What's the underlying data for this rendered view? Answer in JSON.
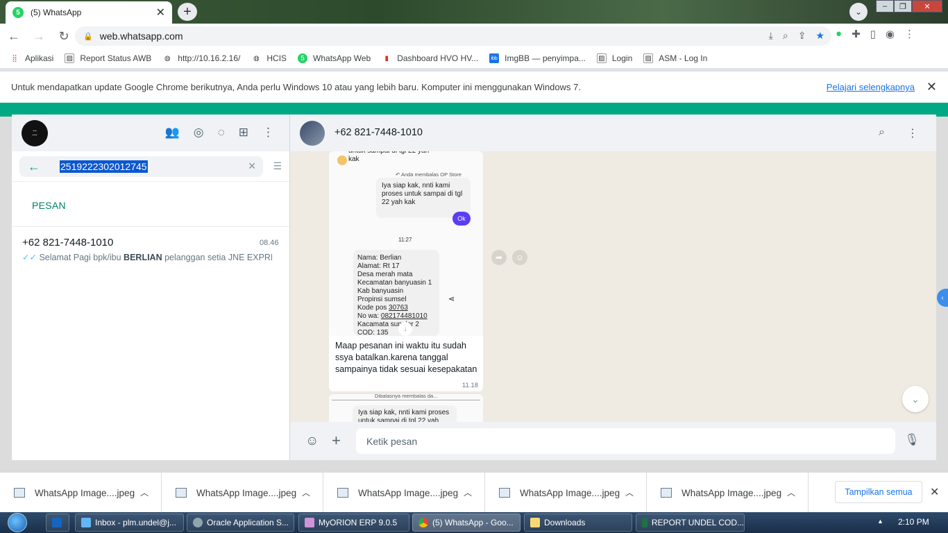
{
  "browser": {
    "tab_title": "(5) WhatsApp",
    "url": "web.whatsapp.com",
    "bookmarks": [
      {
        "label": "Aplikasi"
      },
      {
        "label": "Report Status AWB"
      },
      {
        "label": "http://10.16.2.16/"
      },
      {
        "label": "HCIS"
      },
      {
        "label": "WhatsApp Web"
      },
      {
        "label": "Dashboard HVO HV..."
      },
      {
        "label": "ImgBB — penyimpa..."
      },
      {
        "label": "Login"
      },
      {
        "label": "ASM - Log In"
      }
    ],
    "infobar_text": "Untuk mendapatkan update Google Chrome berikutnya, Anda perlu Windows 10 atau yang lebih baru. Komputer ini menggunakan Windows 7.",
    "infobar_link": "Pelajari selengkapnya"
  },
  "whatsapp": {
    "search": {
      "value": "2519222302012745"
    },
    "section_label": "PESAN",
    "result": {
      "name": "+62 821-7448-1010",
      "time": "08.46",
      "preview_prefix": "Selamat Pagi  bpk/ibu ",
      "preview_bold": "BERLIAN",
      "preview_suffix": " pelanggan setia JNE EXPRE..."
    },
    "contact_name": "+62 821-7448-1010",
    "screenshot": {
      "top_text": "untuk sampai di tgl 22 yah\nkak",
      "reply_label": "↶ Anda membalas OP Store",
      "outgoing": "Iya siap kak, nnti kami proses untuk sampai di tgl 22 yah kak",
      "ok": "Ok",
      "time": "11:27",
      "card_lines": [
        "Nama: Berlian",
        "Alamat: Rt 17",
        "Desa merah mata",
        "Kecamatan banyuasin 1",
        "Kab banyuasin",
        "Propinsi sumsel"
      ],
      "kode_pos_label": "Kode pos ",
      "kode_pos": "30763",
      "no_wa_label": "No wa: ",
      "no_wa": "082174481010",
      "card_line_kacamata": "Kacamata sunglor 2",
      "card_line_cod": "COD: 135"
    },
    "caption": "Maap pesanan ini waktu itu sudah ssya batalkan.karena tanggal sampainya tidak sesuai kesepakatan",
    "caption_time": "11.18",
    "second_bubble_text": "Iya siap kak, nnti kami proses untuk sampai di tgl 22 yah",
    "second_bubble_reply": "Dibalasnya membalas da...",
    "compose_placeholder": "Ketik pesan"
  },
  "downloads": {
    "items": [
      {
        "name": "WhatsApp Image....jpeg"
      },
      {
        "name": "WhatsApp Image....jpeg"
      },
      {
        "name": "WhatsApp Image....jpeg"
      },
      {
        "name": "WhatsApp Image....jpeg"
      },
      {
        "name": "WhatsApp Image....jpeg"
      }
    ],
    "show_all": "Tampilkan semua"
  },
  "taskbar": {
    "items": [
      {
        "label": "Inbox - plm.undel@j..."
      },
      {
        "label": "Oracle Application S..."
      },
      {
        "label": "MyORION ERP 9.0.5"
      },
      {
        "label": "(5) WhatsApp - Goo..."
      },
      {
        "label": "Downloads"
      },
      {
        "label": "REPORT UNDEL COD..."
      }
    ],
    "clock": "2:10 PM"
  },
  "colors": {
    "accent": "#00a884",
    "link": "#1a73e8"
  }
}
